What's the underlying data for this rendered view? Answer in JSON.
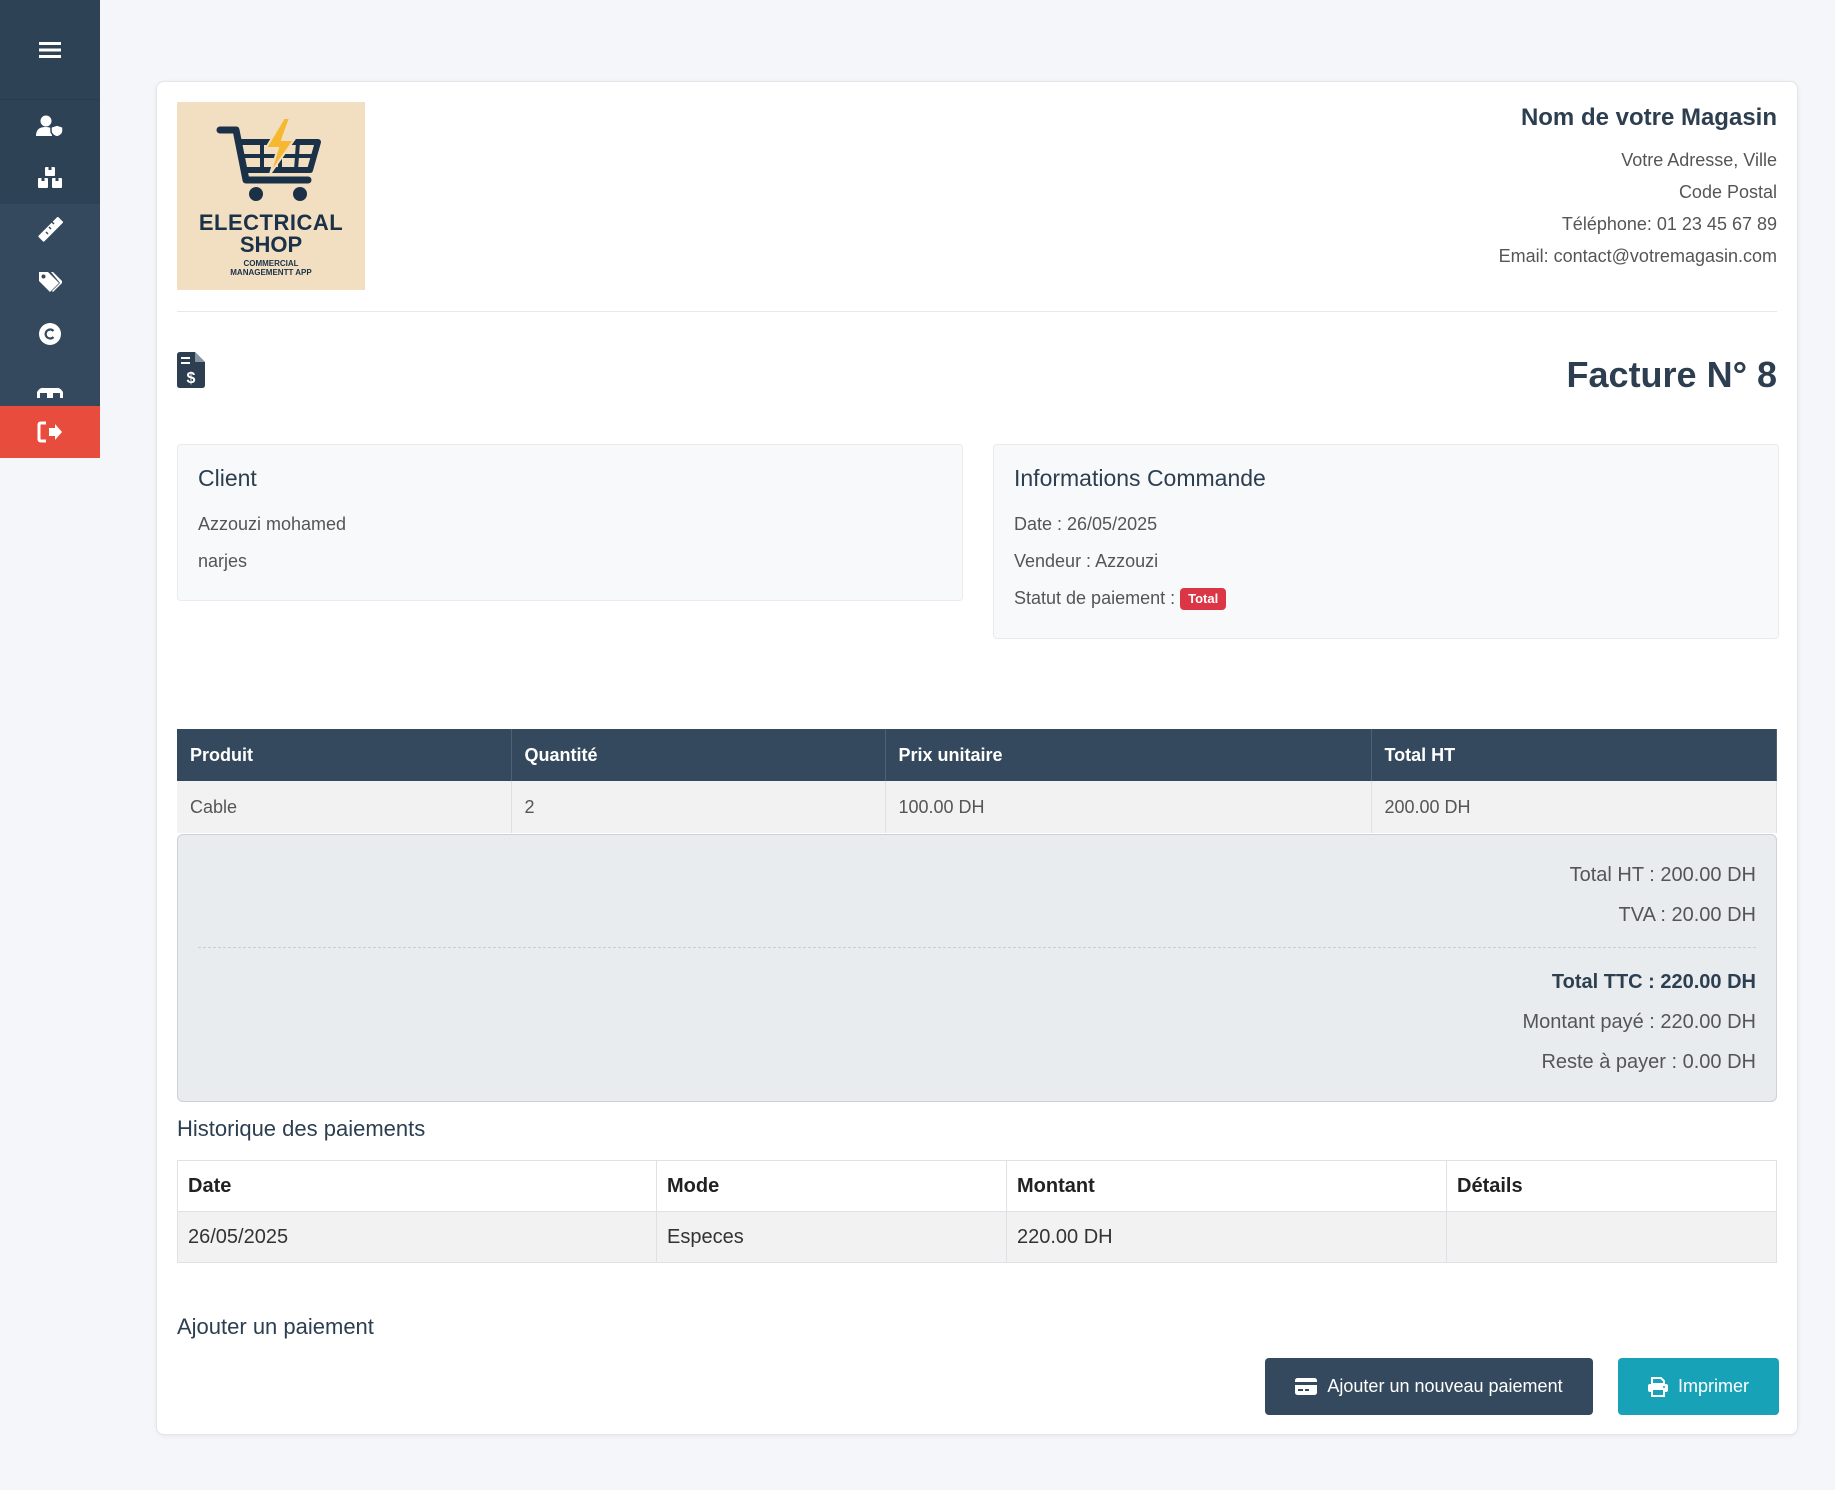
{
  "sidebar": {
    "menu_icon": "hamburger-icon",
    "items": [
      {
        "icon": "user-shield-icon"
      },
      {
        "icon": "boxes-icon"
      },
      {
        "icon": "ruler-icon"
      },
      {
        "icon": "tags-icon"
      },
      {
        "icon": "copyright-icon"
      },
      {
        "icon": "glasses-icon"
      }
    ],
    "logout_icon": "logout-icon"
  },
  "logo": {
    "line1": "ELECTRICAL",
    "line2": "SHOP",
    "line3": "COMMERCIAL MANAGEMENTT APP"
  },
  "shop": {
    "name": "Nom de votre Magasin",
    "address": "Votre Adresse, Ville",
    "postal": "Code Postal",
    "phone": "Téléphone: 01 23 45 67 89",
    "email": "Email: contact@votremagasin.com"
  },
  "invoice": {
    "title": "Facture N° 8",
    "icon": "file-invoice-dollar-icon"
  },
  "client": {
    "title": "Client",
    "name": "Azzouzi mohamed",
    "extra": "narjes"
  },
  "order": {
    "title": "Informations Commande",
    "date": "Date : 26/05/2025",
    "seller": "Vendeur : Azzouzi",
    "status_label": "Statut de paiement :",
    "status_badge": "Total",
    "badge_color": "#dc3545"
  },
  "products_table": {
    "headers": [
      "Produit",
      "Quantité",
      "Prix unitaire",
      "Total HT"
    ],
    "rows": [
      [
        "Cable",
        "2",
        "100.00 DH",
        "200.00 DH"
      ]
    ]
  },
  "totals": {
    "total_ht": "Total HT : 200.00 DH",
    "tva": "TVA : 20.00 DH",
    "total_ttc": "Total TTC : 220.00 DH",
    "paid": "Montant payé : 220.00 DH",
    "remaining": "Reste à payer : 0.00 DH"
  },
  "payments": {
    "title": "Historique des paiements",
    "headers": [
      "Date",
      "Mode",
      "Montant",
      "Détails"
    ],
    "rows": [
      [
        "26/05/2025",
        "Especes",
        "220.00 DH",
        ""
      ]
    ]
  },
  "add_payment": {
    "title": "Ajouter un paiement",
    "add_button": "Ajouter un nouveau paiement",
    "print_button": "Imprimer"
  },
  "colors": {
    "sidebar": "#34495e",
    "logout": "#e74c3c",
    "primary_dark": "#34495e",
    "print_button": "#17a2b8"
  }
}
